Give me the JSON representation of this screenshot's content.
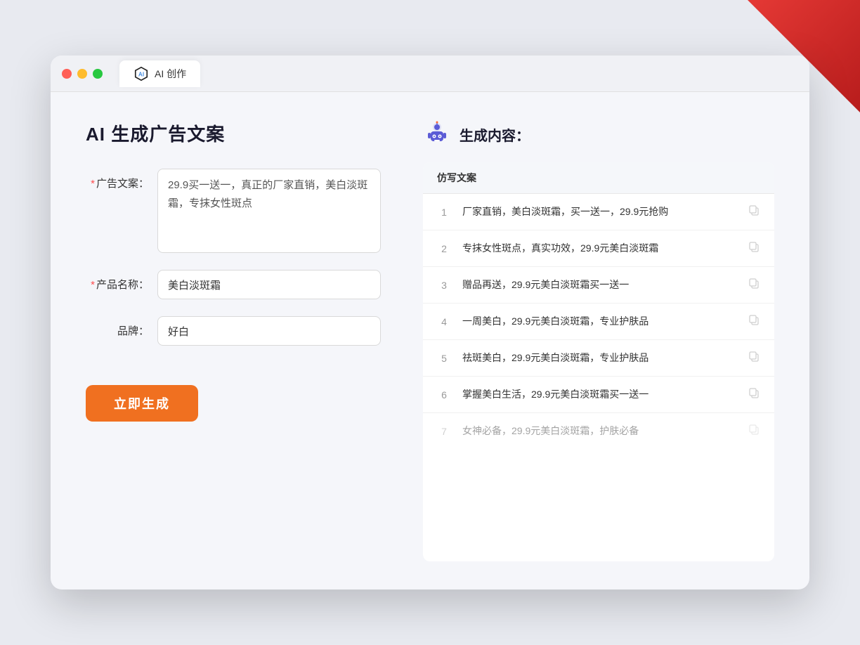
{
  "window": {
    "tab_label": "AI 创作"
  },
  "header": {
    "title": "AI 生成广告文案"
  },
  "form": {
    "ad_copy_label": "广告文案：",
    "ad_copy_required": "*",
    "ad_copy_value": "29.9买一送一，真正的厂家直销，美白淡斑霜，专抹女性斑点",
    "product_name_label": "产品名称：",
    "product_name_required": "*",
    "product_name_value": "美白淡斑霜",
    "brand_label": "品牌：",
    "brand_value": "好白",
    "generate_btn_label": "立即生成"
  },
  "results": {
    "header_label": "生成内容：",
    "column_label": "仿写文案",
    "items": [
      {
        "number": "1",
        "text": "厂家直销，美白淡斑霜，买一送一，29.9元抢购",
        "dimmed": false
      },
      {
        "number": "2",
        "text": "专抹女性斑点，真实功效，29.9元美白淡斑霜",
        "dimmed": false
      },
      {
        "number": "3",
        "text": "赠品再送，29.9元美白淡斑霜买一送一",
        "dimmed": false
      },
      {
        "number": "4",
        "text": "一周美白，29.9元美白淡斑霜，专业护肤品",
        "dimmed": false
      },
      {
        "number": "5",
        "text": "祛斑美白，29.9元美白淡斑霜，专业护肤品",
        "dimmed": false
      },
      {
        "number": "6",
        "text": "掌握美白生活，29.9元美白淡斑霜买一送一",
        "dimmed": false
      },
      {
        "number": "7",
        "text": "女神必备，29.9元美白淡斑霜，护肤必备",
        "dimmed": true
      }
    ]
  }
}
